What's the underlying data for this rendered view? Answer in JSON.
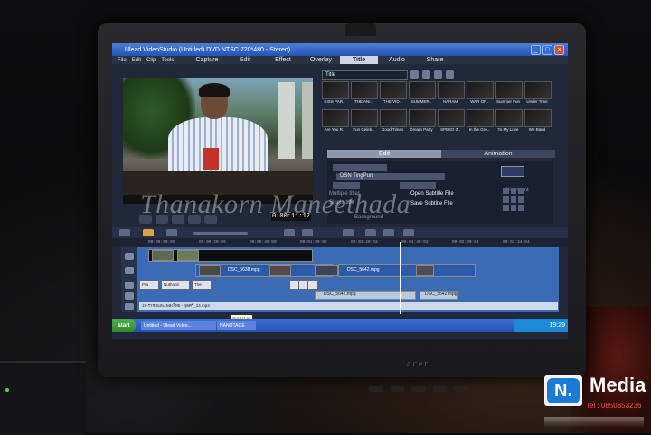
{
  "window": {
    "title": "Ulead VideoStudio (Untitled) DVD NTSC 720*480 - Stereo)"
  },
  "menu": [
    "File",
    "Edit",
    "Clip",
    "Tools"
  ],
  "steps": [
    {
      "label": "Capture",
      "active": false
    },
    {
      "label": "Edit",
      "active": false
    },
    {
      "label": "Effect",
      "active": false
    },
    {
      "label": "Overlay",
      "active": false
    },
    {
      "label": "Title",
      "active": true
    },
    {
      "label": "Audio",
      "active": false
    },
    {
      "label": "Share",
      "active": false
    }
  ],
  "library": {
    "dropdown": "Title",
    "thumbs": [
      "KISS PAR..",
      "THE ANI..",
      "THE VID..",
      "SUMMER..",
      "HARAM",
      "WAR OF..",
      "Summer Fun",
      "Under Time",
      "Are You R..",
      "Fun Celeb..",
      "Good Times",
      "Dream Party",
      "SPEED Z..",
      "In the Gro..",
      "To My Love",
      "We Band"
    ]
  },
  "options": {
    "tabs": [
      {
        "label": "Edit",
        "active": true
      },
      {
        "label": "Animation",
        "active": false
      }
    ],
    "font": "DSN TingPun",
    "open_subtitle": "Open Subtitle File",
    "save_subtitle": "Save Subtitle File",
    "multiple_titles": "Multiple titles",
    "single_title": "Single title",
    "background": "Background",
    "alignment": "Alignment"
  },
  "player": {
    "timecode": "0:00:11:12"
  },
  "ruler": [
    "00:00:00:00",
    "00:00:20:00",
    "00:00:40:00",
    "00:01:00:02",
    "00:01:20:02",
    "00:01:40:02",
    "00:02:00:04",
    "00:02:24:04"
  ],
  "timeline": {
    "video_clips": [
      "DSC_5638.mpg",
      "DSC_5642.mpg"
    ],
    "title_clips": [
      "Pra",
      "Nuthanit",
      "The"
    ],
    "overlay_clips": [
      "DSC_5642.mpg",
      "DSC_5642.mpg"
    ],
    "music": "19-ราชาและเพลงไทย - ผุดศรี_14.mp3",
    "tooltip": "00:01:11:03"
  },
  "taskbar": {
    "start": "start",
    "tasks": [
      "Untitled - Ulead Video...",
      "NANOTAGE"
    ],
    "clock": "19:29"
  },
  "watermark": "Thanakorn Maneethada",
  "logo": {
    "letter": "N.",
    "word": "Media",
    "tel1": "Tel : 0850853236",
    "tel2": "Tel : 0850853236"
  },
  "colors": {
    "timeline": "#3a6bb4",
    "titlebar": "#2353b8",
    "logo_accent": "#1b79d8"
  }
}
